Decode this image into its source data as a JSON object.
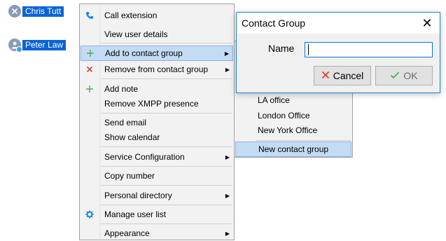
{
  "users": [
    {
      "name": "Chris Tutt",
      "avatar_color": "#8a9bb6",
      "badge_icon": "close-icon"
    },
    {
      "name": "Peter Law",
      "avatar_color": "#8a9bb6",
      "badge_icon": "presence-dot"
    }
  ],
  "context_menu": {
    "items": [
      {
        "label": "Call extension",
        "icon": "phone-icon"
      },
      {
        "label": "View user details"
      },
      {
        "label": "Add to contact group",
        "icon": "plus-icon",
        "has_submenu": true,
        "highlighted": true
      },
      {
        "label": "Remove from contact group",
        "icon": "x-icon",
        "has_submenu": true
      },
      {
        "label": "Add note",
        "icon": "plus-icon"
      },
      {
        "label": "Remove XMPP presence"
      },
      {
        "label": "Send email"
      },
      {
        "label": "Show calendar"
      },
      {
        "label": "Service Configuration",
        "has_submenu": true
      },
      {
        "label": "Copy number"
      },
      {
        "label": "Personal directory",
        "has_submenu": true
      },
      {
        "label": "Manage user list",
        "icon": "gear-icon"
      },
      {
        "label": "Appearance",
        "has_submenu": true
      }
    ]
  },
  "submenu": {
    "items": [
      {
        "label": "LA office"
      },
      {
        "label": "London Office"
      },
      {
        "label": "New York Office"
      },
      {
        "label": "New contact group",
        "highlighted": true
      }
    ]
  },
  "dialog": {
    "title": "Contact Group",
    "close_glyph": "✕",
    "name_label": "Name",
    "name_value": "",
    "cancel_label": "Cancel",
    "ok_label": "OK"
  },
  "colors": {
    "selection": "#0a64d6",
    "menu_highlight": "#c4dcf3",
    "green_icon": "#4caf50",
    "red_icon": "#e53935",
    "phone_blue": "#1e88e5",
    "dialog_border": "#1883d7"
  }
}
